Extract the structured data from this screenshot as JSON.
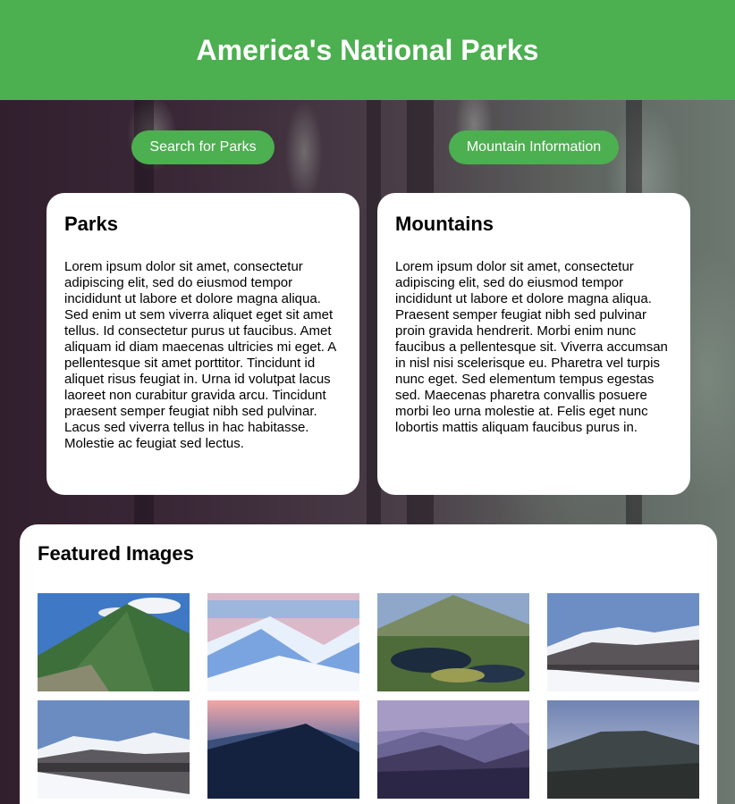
{
  "header": {
    "title": "America's National Parks"
  },
  "nav": {
    "parks_button": "Search for Parks",
    "mountains_button": "Mountain Information"
  },
  "cards": {
    "parks": {
      "title": "Parks",
      "body": "Lorem ipsum dolor sit amet, consectetur adipiscing elit, sed do eiusmod tempor incididunt ut labore et dolore magna aliqua. Sed enim ut sem viverra aliquet eget sit amet tellus. Id consectetur purus ut faucibus. Amet aliquam id diam maecenas ultricies mi eget. A pellentesque sit amet porttitor. Tincidunt id aliquet risus feugiat in. Urna id volutpat lacus laoreet non curabitur gravida arcu. Tincidunt praesent semper feugiat nibh sed pulvinar. Lacus sed viverra tellus in hac habitasse. Molestie ac feugiat sed lectus."
    },
    "mountains": {
      "title": "Mountains",
      "body": "Lorem ipsum dolor sit amet, consectetur adipiscing elit, sed do eiusmod tempor incididunt ut labore et dolore magna aliqua. Praesent semper feugiat nibh sed pulvinar proin gravida hendrerit. Morbi enim nunc faucibus a pellentesque sit. Viverra accumsan in nisl nisi scelerisque eu. Pharetra vel turpis nunc eget. Sed elementum tempus egestas sed. Maecenas pharetra convallis posuere morbi leo urna molestie at. Felis eget nunc lobortis mattis aliquam faucibus purus in."
    }
  },
  "featured": {
    "title": "Featured Images",
    "images": [
      "green-mountain-peak",
      "snowy-ridges",
      "alpine-pond-peak",
      "snowcapped-range",
      "snowy-range-slope",
      "dusk-peak-silhouette",
      "purple-haze-mountains",
      "forested-summit"
    ]
  },
  "colors": {
    "accent": "#4caf50",
    "card": "#ffffff"
  }
}
